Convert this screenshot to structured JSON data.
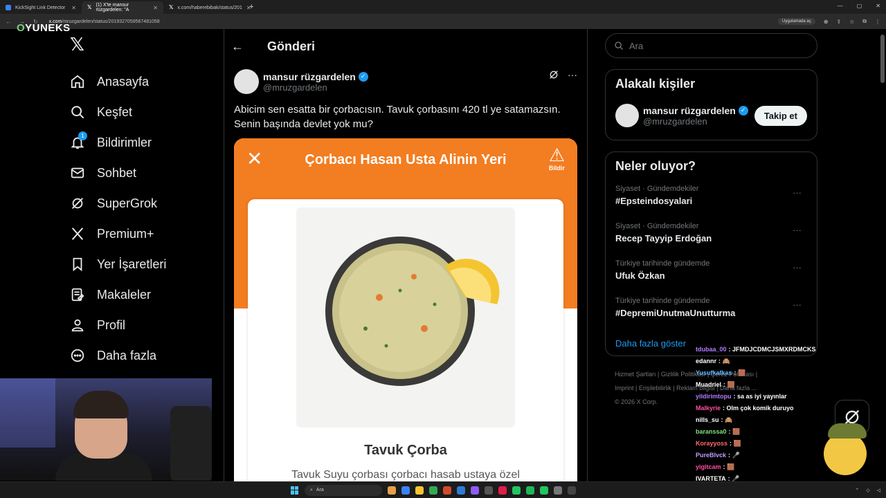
{
  "browser": {
    "tabs": [
      {
        "title": "KickSight Link Detector",
        "active": false
      },
      {
        "title": "(1) X'te mansur rüzgardelen: \"A",
        "active": true
      },
      {
        "title": "x.com/haberebibak/status/201",
        "active": false
      }
    ],
    "url_domain": "x.com",
    "url_path": "/mruzgardelen/status/2019327059567481058",
    "app_pill": "Uygulamada aç"
  },
  "overlay_logo": {
    "o": "O",
    "rest": "YUNEKS"
  },
  "nav": {
    "items": [
      {
        "label": "Anasayfa",
        "icon": "home-icon"
      },
      {
        "label": "Keşfet",
        "icon": "search-icon"
      },
      {
        "label": "Bildirimler",
        "icon": "bell-icon",
        "badge": "1"
      },
      {
        "label": "Sohbet",
        "icon": "mail-icon"
      },
      {
        "label": "SuperGrok",
        "icon": "grok-icon"
      },
      {
        "label": "Premium+",
        "icon": "x-icon"
      },
      {
        "label": "Yer İşaretleri",
        "icon": "bookmark-icon"
      },
      {
        "label": "Makaleler",
        "icon": "article-icon"
      },
      {
        "label": "Profil",
        "icon": "profile-icon"
      },
      {
        "label": "Daha fazla",
        "icon": "more-icon"
      }
    ]
  },
  "post": {
    "header_title": "Gönderi",
    "display_name": "mansur rüzgardelen",
    "handle": "@mruzgardelen",
    "text": "Abicim sen esatta bir çorbacısın. Tavuk çorbasını 420 tl ye satamazsın. Senin başında devlet yok mu?",
    "media": {
      "title": "Çorbacı Hasan Usta Alinin Yeri",
      "report_label": "Bildir",
      "food_name": "Tavuk Çorba",
      "food_desc": "Tavuk Suyu çorbası çorbacı hasab ustaya özel"
    }
  },
  "sidebar": {
    "search_placeholder": "Ara",
    "related_title": "Alakalı kişiler",
    "related_person": {
      "name": "mansur rüzgardelen",
      "handle": "@mruzgardelen",
      "follow_label": "Takip et"
    },
    "trends_title": "Neler oluyor?",
    "trends": [
      {
        "category": "Siyaset · Gündemdekiler",
        "name": "#Epsteindosyalari"
      },
      {
        "category": "Siyaset · Gündemdekiler",
        "name": "Recep Tayyip Erdoğan"
      },
      {
        "category": "Türkiye tarihinde gündemde",
        "name": "Ufuk Özkan"
      },
      {
        "category": "Türkiye tarihinde gündemde",
        "name": "#DepremiUnutmaUnutturma"
      }
    ],
    "show_more": "Daha fazla göster",
    "footer_line1": "Hizmet Şartları  |  Gizlilik Politikası  |  Çerez Politikası  |",
    "footer_line2": "Imprint  |  Erişilebilirlik  |  Reklam bilgisi  |  Daha fazla ...",
    "footer_line3": "© 2026 X Corp."
  },
  "chat": {
    "messages": [
      {
        "user": "tdubaa_00",
        "text": "JFMDJCDMCJSMXRDMCKS",
        "color": "#b07cff"
      },
      {
        "user": "edannr",
        "text": "🙈",
        "color": "#ffffff"
      },
      {
        "user": "Yusufkafkas",
        "text": "🟫",
        "color": "#5fb6ff"
      },
      {
        "user": "Muadriel",
        "text": "🟫",
        "color": "#ffffff"
      },
      {
        "user": "yildirimtopu",
        "text": "sa as iyi yayınlar",
        "color": "#b07cff"
      },
      {
        "user": "Malkyrie",
        "text": "Olm çok komik duruyo",
        "color": "#ff4fa3"
      },
      {
        "user": "nills_su",
        "text": "🙈",
        "color": "#ffffff"
      },
      {
        "user": "baranssa0",
        "text": "🟫",
        "color": "#7ee07e"
      },
      {
        "user": "Korayyoss",
        "text": "🟫",
        "color": "#ff6b6b"
      },
      {
        "user": "PureBlvck",
        "text": "🎤",
        "color": "#c49bff"
      },
      {
        "user": "yigitcam",
        "text": "🟫",
        "color": "#ff4fa3"
      },
      {
        "user": "IVARTETA",
        "text": "🎤",
        "color": "#ffffff"
      }
    ]
  },
  "taskbar": {
    "search_placeholder": "Ara"
  },
  "colors": {
    "accent": "#1d9bf0",
    "orange": "#f37d21"
  }
}
